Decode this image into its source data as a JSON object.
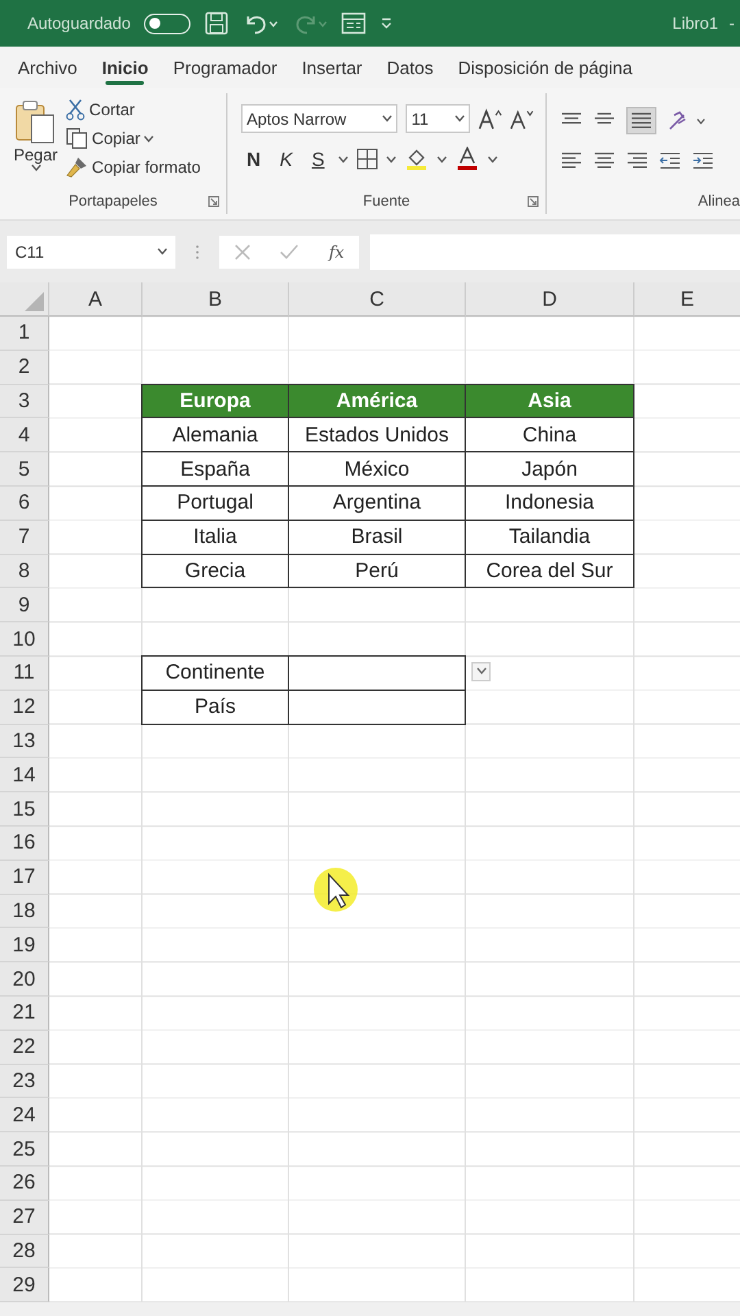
{
  "title_bar": {
    "autosave_label": "Autoguardado",
    "autosave_on": false,
    "file_name": "Libro1",
    "file_suffix": "-"
  },
  "tabs": [
    {
      "label": "Archivo",
      "selected": false
    },
    {
      "label": "Inicio",
      "selected": true
    },
    {
      "label": "Programador",
      "selected": false
    },
    {
      "label": "Insertar",
      "selected": false
    },
    {
      "label": "Datos",
      "selected": false
    },
    {
      "label": "Disposición de página",
      "selected": false
    }
  ],
  "ribbon": {
    "clipboard": {
      "paste": "Pegar",
      "cut": "Cortar",
      "copy": "Copiar",
      "format_painter": "Copiar formato",
      "group_label": "Portapapeles"
    },
    "font": {
      "font_name": "Aptos Narrow",
      "font_size": "11",
      "bold": "N",
      "italic": "K",
      "underline": "S",
      "group_label": "Fuente"
    },
    "alignment": {
      "group_label": "Alinea"
    }
  },
  "formula_bar": {
    "name_box": "C11",
    "function_label": "fx"
  },
  "sheet": {
    "columns": [
      "A",
      "B",
      "C",
      "D",
      "E"
    ],
    "rows": [
      {
        "number": "1",
        "cells": []
      },
      {
        "number": "2",
        "cells": []
      },
      {
        "number": "3",
        "cells": [
          {
            "kind": "blank"
          },
          {
            "text": "Europa",
            "kind": "header"
          },
          {
            "text": "América",
            "kind": "header"
          },
          {
            "text": "Asia",
            "kind": "header"
          }
        ]
      },
      {
        "number": "4",
        "cells": [
          {
            "kind": "blank"
          },
          {
            "text": "Alemania",
            "kind": "bordered"
          },
          {
            "text": "Estados Unidos",
            "kind": "bordered"
          },
          {
            "text": "China",
            "kind": "bordered"
          }
        ]
      },
      {
        "number": "5",
        "cells": [
          {
            "kind": "blank"
          },
          {
            "text": "España",
            "kind": "bordered"
          },
          {
            "text": "México",
            "kind": "bordered"
          },
          {
            "text": "Japón",
            "kind": "bordered"
          }
        ]
      },
      {
        "number": "6",
        "cells": [
          {
            "kind": "blank"
          },
          {
            "text": "Portugal",
            "kind": "bordered"
          },
          {
            "text": "Argentina",
            "kind": "bordered"
          },
          {
            "text": "Indonesia",
            "kind": "bordered"
          }
        ]
      },
      {
        "number": "7",
        "cells": [
          {
            "kind": "blank"
          },
          {
            "text": "Italia",
            "kind": "bordered"
          },
          {
            "text": "Brasil",
            "kind": "bordered"
          },
          {
            "text": "Tailandia",
            "kind": "bordered"
          }
        ]
      },
      {
        "number": "8",
        "cells": [
          {
            "kind": "blank"
          },
          {
            "text": "Grecia",
            "kind": "bordered"
          },
          {
            "text": "Perú",
            "kind": "bordered"
          },
          {
            "text": "Corea del Sur",
            "kind": "bordered"
          }
        ]
      },
      {
        "number": "9",
        "cells": []
      },
      {
        "number": "10",
        "cells": []
      },
      {
        "number": "11",
        "cells": [
          {
            "kind": "blank"
          },
          {
            "text": "Continente",
            "kind": "bordered"
          },
          {
            "kind": "bordered",
            "has_dropdown": true
          }
        ]
      },
      {
        "number": "12",
        "cells": [
          {
            "kind": "blank"
          },
          {
            "text": "País",
            "kind": "bordered"
          },
          {
            "kind": "bordered"
          }
        ]
      },
      {
        "number": "13",
        "cells": []
      },
      {
        "number": "14",
        "cells": []
      },
      {
        "number": "15",
        "cells": []
      },
      {
        "number": "16",
        "cells": []
      },
      {
        "number": "17",
        "cells": []
      },
      {
        "number": "18",
        "cells": []
      },
      {
        "number": "19",
        "cells": []
      },
      {
        "number": "20",
        "cells": []
      },
      {
        "number": "21",
        "cells": []
      },
      {
        "number": "22",
        "cells": []
      },
      {
        "number": "23",
        "cells": []
      },
      {
        "number": "24",
        "cells": []
      },
      {
        "number": "25",
        "cells": []
      },
      {
        "number": "26",
        "cells": []
      },
      {
        "number": "27",
        "cells": []
      },
      {
        "number": "28",
        "cells": []
      },
      {
        "number": "29",
        "cells": []
      }
    ]
  }
}
